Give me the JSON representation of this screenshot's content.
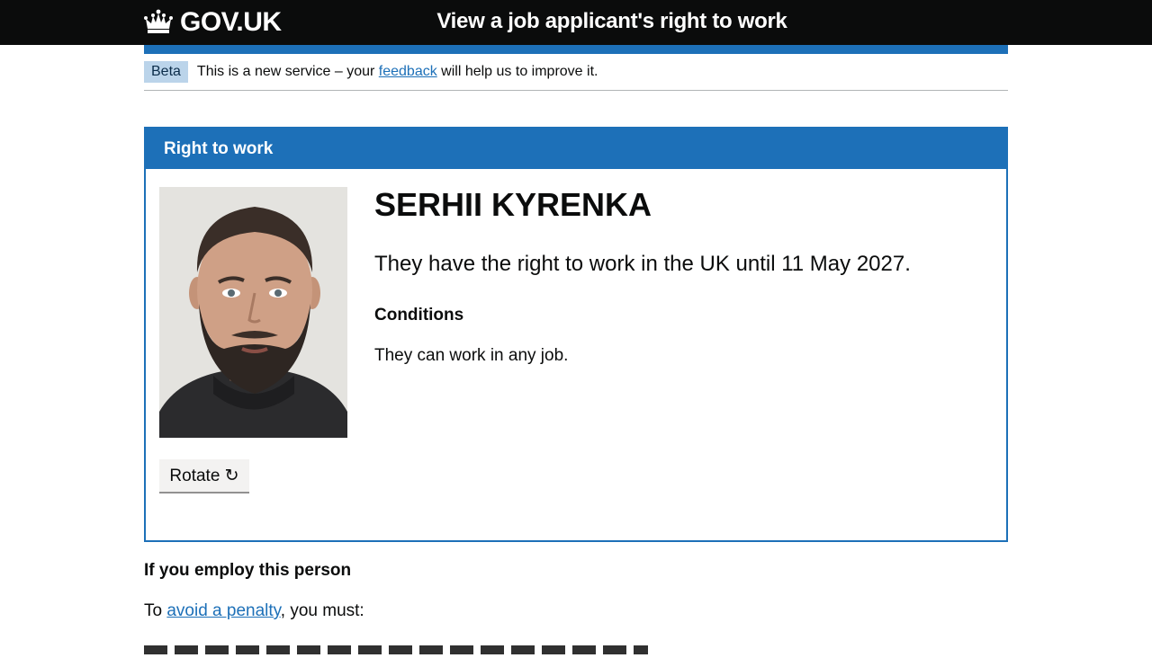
{
  "header": {
    "logo_text": "GOV.UK",
    "service_name": "View a job applicant's right to work"
  },
  "phase_banner": {
    "tag": "Beta",
    "text_before": "This is a new service – your ",
    "link_text": "feedback",
    "text_after": " will help us to improve it."
  },
  "panel": {
    "title": "Right to work",
    "person_name": "SERHII KYRENKA",
    "right_to_work_text": "They have the right to work in the UK until 11 May 2027.",
    "conditions_heading": "Conditions",
    "conditions_text": "They can work in any job.",
    "rotate_label": "Rotate ↻"
  },
  "employ_section": {
    "heading": "If you employ this person",
    "text_before": "To ",
    "link_text": "avoid a penalty",
    "text_after": ", you must:"
  },
  "colors": {
    "header_bg": "#0b0c0c",
    "brand_blue": "#1d70b8",
    "beta_tag_bg": "#bbd4ea",
    "link": "#1d70b8"
  }
}
